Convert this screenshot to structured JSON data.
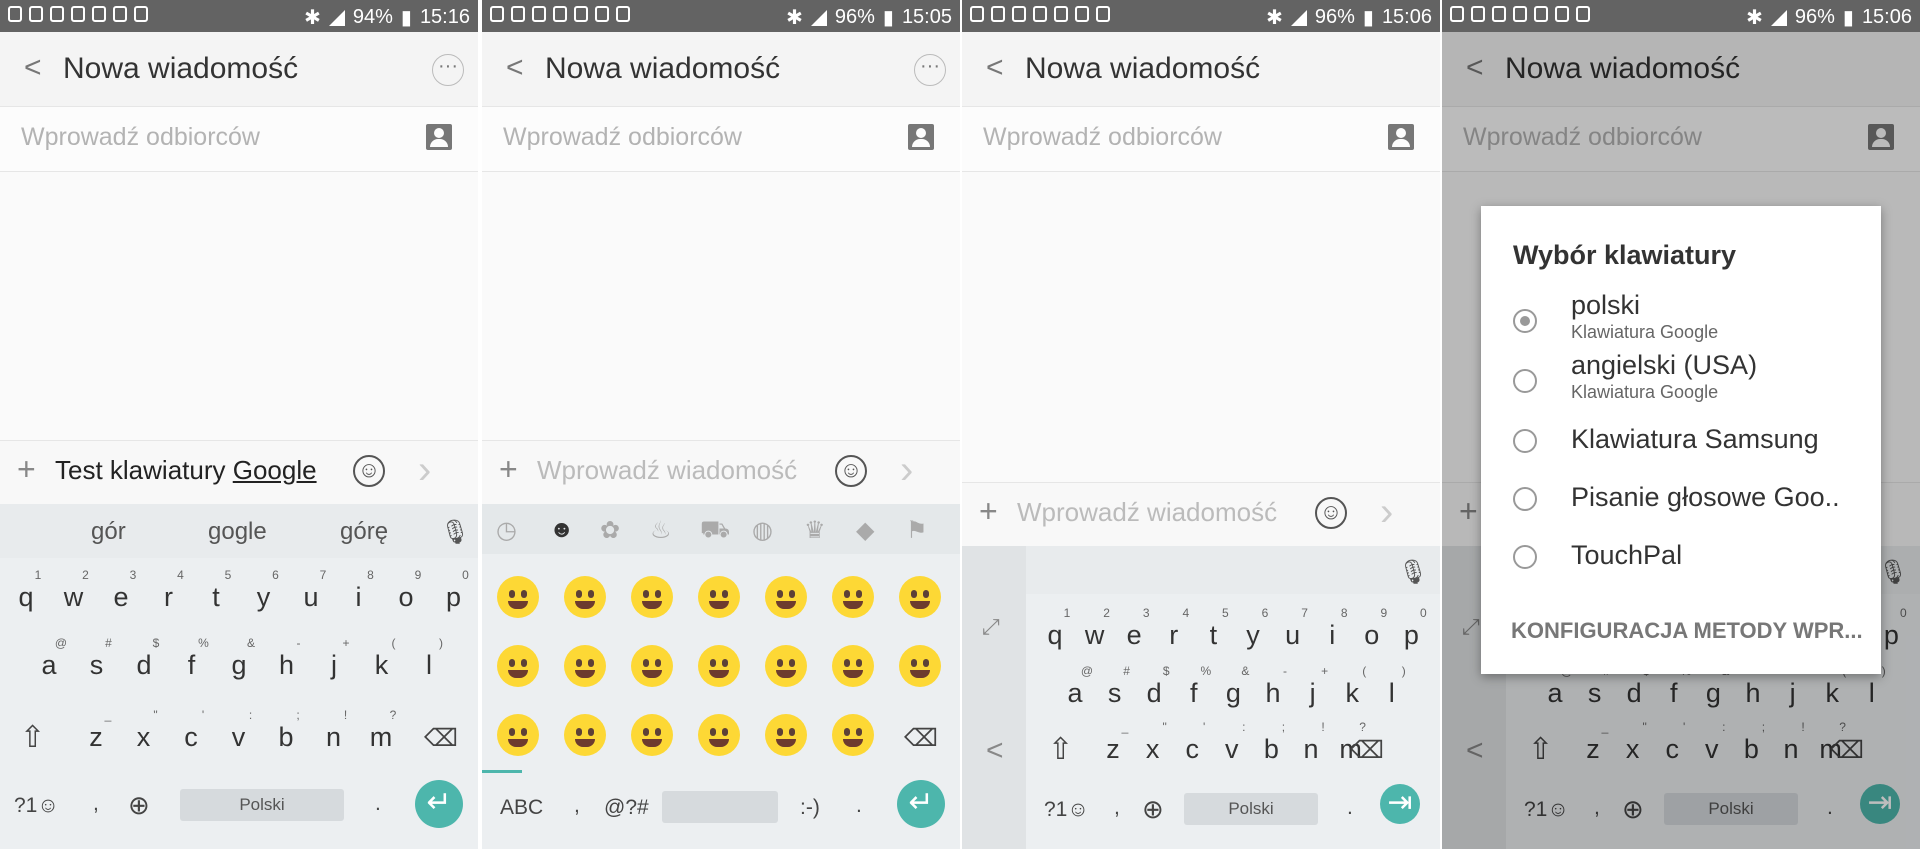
{
  "status": [
    {
      "battery": "94%",
      "time": "15:16"
    },
    {
      "battery": "96%",
      "time": "15:05"
    },
    {
      "battery": "96%",
      "time": "15:06"
    },
    {
      "battery": "96%",
      "time": "15:06"
    }
  ],
  "header": {
    "title": "Nowa wiadomość"
  },
  "recipients": {
    "placeholder": "Wprowadź odbiorców"
  },
  "compose": {
    "placeholder": "Wprowadź wiadomość",
    "typed_text": "Test klawiatury",
    "underlined_word": "Google"
  },
  "suggestions": [
    "gór",
    "gogle",
    "górę"
  ],
  "keyboard": {
    "row1": [
      "q",
      "w",
      "e",
      "r",
      "t",
      "y",
      "u",
      "i",
      "o",
      "p"
    ],
    "row1_hints": [
      "1",
      "2",
      "3",
      "4",
      "5",
      "6",
      "7",
      "8",
      "9",
      "0"
    ],
    "row2": [
      "a",
      "s",
      "d",
      "f",
      "g",
      "h",
      "j",
      "k",
      "l"
    ],
    "row2_hints": [
      "@",
      "#",
      "$",
      "%",
      "&",
      "-",
      "+",
      "(",
      ")"
    ],
    "row3": [
      "z",
      "x",
      "c",
      "v",
      "b",
      "n",
      "m"
    ],
    "row3_hints": [
      "_",
      "\"",
      "'",
      ":",
      ";",
      "!",
      "?"
    ],
    "sym_label": "?1☺",
    "comma": ",",
    "period": ".",
    "space_label": "Polski"
  },
  "emoji_keyboard": {
    "abc_label": "ABC",
    "sym_label": "@?#",
    "emoticon_label": ":-)"
  },
  "dialog": {
    "title": "Wybór klawiatury",
    "options": [
      {
        "label": "polski",
        "sub": "Klawiatura Google",
        "selected": true
      },
      {
        "label": "angielski (USA)",
        "sub": "Klawiatura Google",
        "selected": false
      },
      {
        "label": "Klawiatura Samsung",
        "sub": "",
        "selected": false
      },
      {
        "label": "Pisanie głosowe Goo..",
        "sub": "",
        "selected": false
      },
      {
        "label": "TouchPal",
        "sub": "",
        "selected": false
      }
    ],
    "config": "KONFIGURACJA METODY WPR..."
  },
  "colors": {
    "accent": "#4db6ac",
    "status_bar": "#636363",
    "keyboard_bg": "#eceff1",
    "emoji": "#fdd835"
  },
  "icons": [
    "back-icon",
    "more-icon",
    "contact-icon",
    "plus-icon",
    "smiley-icon",
    "send-icon",
    "mic-icon",
    "shift-icon",
    "backspace-icon",
    "globe-icon",
    "enter-icon",
    "expand-icon",
    "radio-icon"
  ]
}
